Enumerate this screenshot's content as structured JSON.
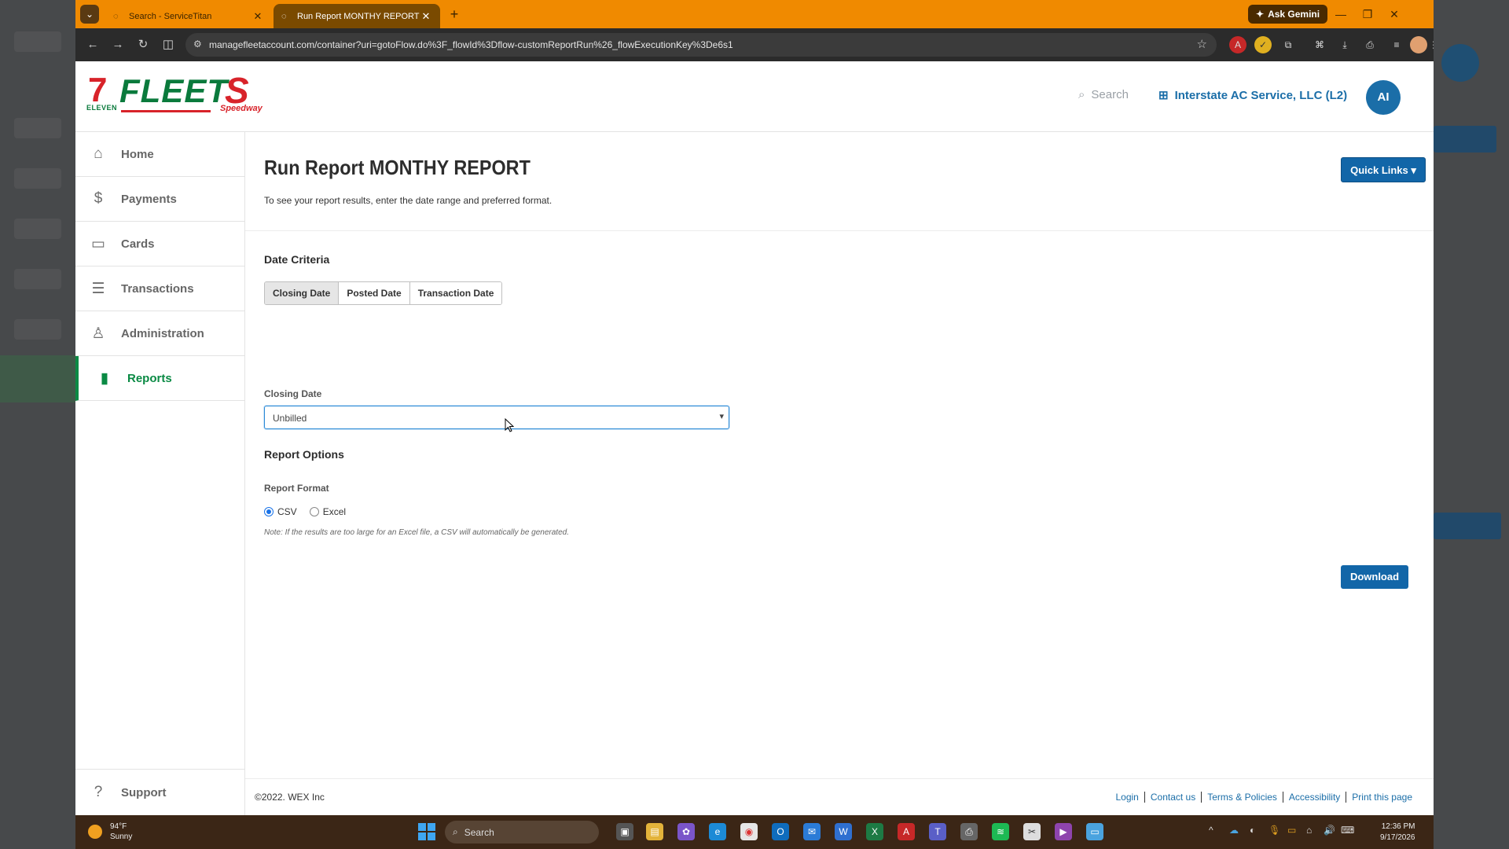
{
  "browser": {
    "tabs": [
      {
        "title": "Search - ServiceTitan",
        "active": false
      },
      {
        "title": "Run Report MONTHY REPORT -",
        "active": true
      }
    ],
    "new_tab_icon": "plus-icon",
    "ask_gemini_label": "Ask Gemini",
    "url": "managefleetaccount.com/container?uri=gotoFlow.do%3F_flowId%3Dflow-customReportRun%26_flowExecutionKey%3De6s1"
  },
  "header": {
    "logo_left": "7",
    "logo_left_sub": "ELEVEN",
    "logo_main": "FLEET",
    "logo_right": "S",
    "logo_right_sub": "Speedway",
    "search_label": "Search",
    "account_label": "Interstate AC Service, LLC  (L2)",
    "avatar_initials": "AI"
  },
  "sidebar": {
    "items": [
      {
        "label": "Home",
        "icon": "home-icon",
        "glyph": "⌂"
      },
      {
        "label": "Payments",
        "icon": "dollar-icon",
        "glyph": "$"
      },
      {
        "label": "Cards",
        "icon": "card-icon",
        "glyph": "▭"
      },
      {
        "label": "Transactions",
        "icon": "receipt-icon",
        "glyph": "☰"
      },
      {
        "label": "Administration",
        "icon": "user-icon",
        "glyph": "♙"
      },
      {
        "label": "Reports",
        "icon": "bar-chart-icon",
        "glyph": "▮"
      }
    ],
    "active_index": 5,
    "support_label": "Support",
    "support_glyph": "?"
  },
  "main": {
    "title": "Run Report MONTHY REPORT",
    "subtitle": "To see your report results, enter the date range and preferred format.",
    "quick_links_label": "Quick Links ▾",
    "date_criteria_title": "Date Criteria",
    "date_tabs": [
      "Closing Date",
      "Posted Date",
      "Transaction Date"
    ],
    "selected_date_tab": 0,
    "closing_date_label": "Closing Date",
    "closing_date_value": "Unbilled",
    "report_options_title": "Report Options",
    "report_format_label": "Report Format",
    "format_options": [
      "CSV",
      "Excel"
    ],
    "selected_format": 0,
    "note": "Note: If the results are too large for an Excel file, a CSV will automatically be generated.",
    "download_label": "Download"
  },
  "footer": {
    "copyright": "©2022. WEX Inc",
    "links": [
      "Login",
      "Contact us",
      "Terms & Policies",
      "Accessibility",
      "Print this page"
    ]
  },
  "taskbar": {
    "temperature": "94°F",
    "condition": "Sunny",
    "search_label": "Search",
    "time": "12:36 PM",
    "date": "9/17/2026"
  },
  "colors": {
    "tab_strip": "#f08a00",
    "accent_blue": "#1266a8",
    "active_green": "#0a8a44"
  }
}
